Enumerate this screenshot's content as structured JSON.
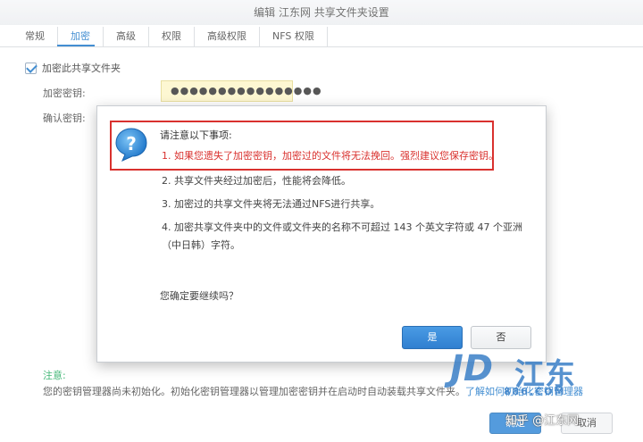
{
  "window": {
    "title": "编辑 江东网 共享文件夹设置"
  },
  "tabs": [
    {
      "label": "常规"
    },
    {
      "label": "加密"
    },
    {
      "label": "高级"
    },
    {
      "label": "权限"
    },
    {
      "label": "高级权限"
    },
    {
      "label": "NFS 权限"
    }
  ],
  "form": {
    "encrypt_checkbox_label": "加密此共享文件夹",
    "key_label": "加密密钥:",
    "key_value": "●●●●●●●●●●●●●●●●",
    "confirm_label": "确认密钥:"
  },
  "note": {
    "title": "注意:",
    "body": "您的密钥管理器尚未初始化。初始化密钥管理器以管理加密密钥并在启动时自动装载共享文件夹。",
    "link": "了解如何初始化密钥管理器"
  },
  "footer": {
    "ok_label": "确定",
    "cancel_label": "取消"
  },
  "dialog": {
    "title": "请注意以下事项:",
    "items": [
      "1. 如果您遗失了加密密钥，加密过的文件将无法挽回。强烈建议您保存密钥。",
      "2. 共享文件夹经过加密后，性能将会降低。",
      "3. 加密过的共享文件夹将无法通过NFS进行共享。",
      "4. 加密共享文件夹中的文件或文件夹的名称不可超过 143 个英文字符或 47 个亚洲（中日韩）字符。"
    ],
    "confirm": "您确定要继续吗？",
    "yes_label": "是",
    "no_label": "否"
  },
  "watermark": {
    "logo": "JD",
    "name": "江东",
    "domain": "886.COM",
    "source": "知乎 @江东网"
  },
  "colors": {
    "accent": "#1a76c8",
    "warning": "#d9312e",
    "note": "#1aa85a"
  }
}
